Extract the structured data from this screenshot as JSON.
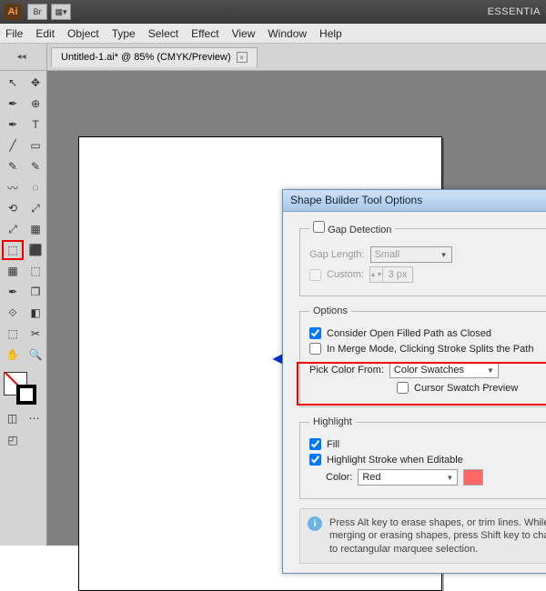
{
  "app": {
    "logo": "Ai",
    "workspace": "ESSENTIA"
  },
  "menubar": [
    "File",
    "Edit",
    "Object",
    "Type",
    "Select",
    "Effect",
    "View",
    "Window",
    "Help"
  ],
  "document": {
    "tab": "Untitled-1.ai* @ 85% (CMYK/Preview)",
    "close": "×"
  },
  "tools": {
    "grid": [
      "↖",
      "✥",
      "✒",
      "⊕",
      "T",
      "╱",
      "▭",
      "✎",
      "〰",
      "◌",
      "✂",
      "⟲",
      "⤢",
      "▦",
      "⬚",
      "⬚",
      "⬛",
      "⬚",
      "✒",
      "❐",
      "⟐",
      "◧",
      "⬚",
      "✧",
      "◫",
      "⋯",
      "◰",
      "⧉",
      "✋",
      "🔍"
    ]
  },
  "dialog": {
    "title": "Shape Builder Tool Options",
    "gap": {
      "legend": "Gap Detection",
      "length_label": "Gap Length:",
      "length_value": "Small",
      "custom_label": "Custom:",
      "custom_value": "3 px"
    },
    "options": {
      "legend": "Options",
      "consider": "Consider Open Filled Path as Closed",
      "merge": "In Merge Mode, Clicking Stroke Splits the Path",
      "pick_label": "Pick Color From:",
      "pick_value": "Color Swatches",
      "cursor": "Cursor Swatch Preview"
    },
    "highlight": {
      "legend": "Highlight",
      "fill": "Fill",
      "stroke": "Highlight Stroke when Editable",
      "color_label": "Color:",
      "color_value": "Red"
    },
    "info": "Press Alt key to erase shapes, or trim lines. While merging or erasing shapes, press Shift key to change to rectangular marquee selection."
  }
}
